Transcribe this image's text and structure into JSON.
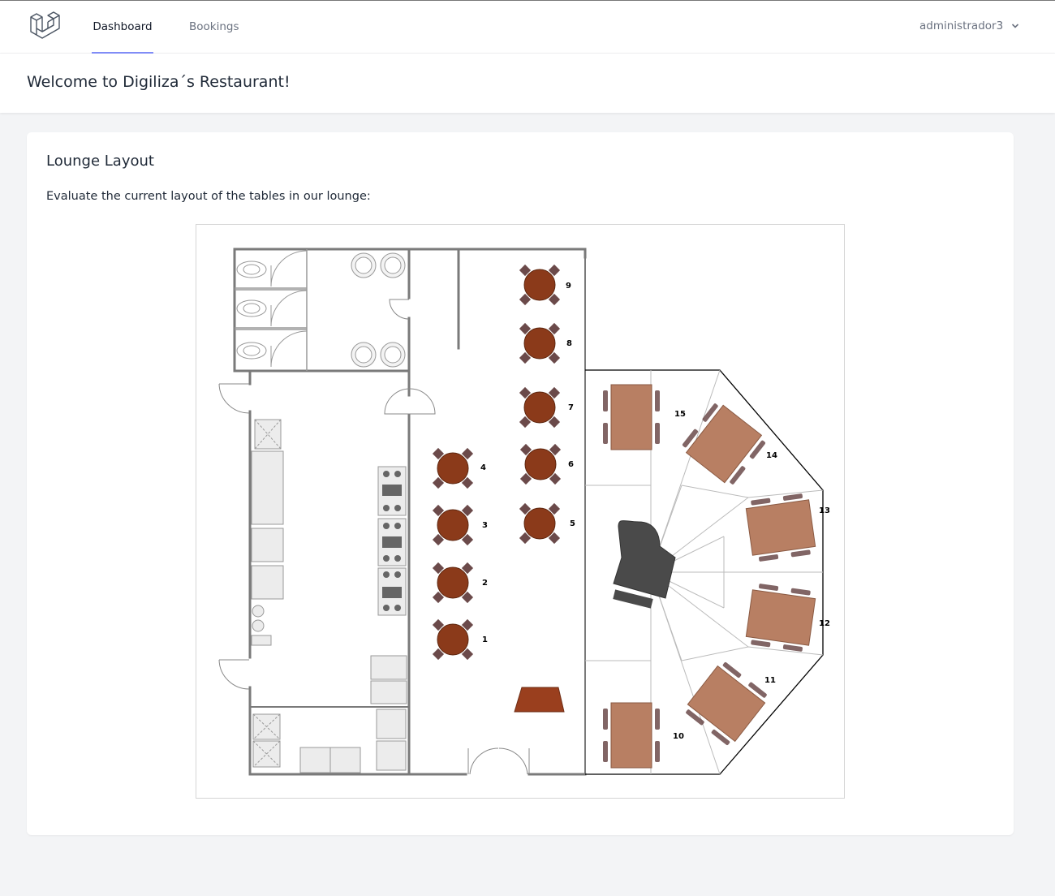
{
  "nav": {
    "links": [
      {
        "label": "Dashboard",
        "active": true
      },
      {
        "label": "Bookings",
        "active": false
      }
    ],
    "user": "administrador3",
    "accent_color": "#818cf8"
  },
  "header": {
    "title": "Welcome to Digiliza´s Restaurant!"
  },
  "card": {
    "title": "Lounge Layout",
    "description": "Evaluate the current layout of the tables in our lounge:"
  },
  "floorplan": {
    "round_tables": [
      "1",
      "2",
      "3",
      "4",
      "5",
      "6",
      "7",
      "8",
      "9"
    ],
    "rect_tables": [
      "10",
      "11",
      "12",
      "13",
      "14",
      "15"
    ],
    "colors": {
      "round_table": "#8b3a1a",
      "rect_table": "#b87f63",
      "chair": "#6b4a4a",
      "wall": "#7a7a7a",
      "piano": "#4a4a4a"
    }
  }
}
